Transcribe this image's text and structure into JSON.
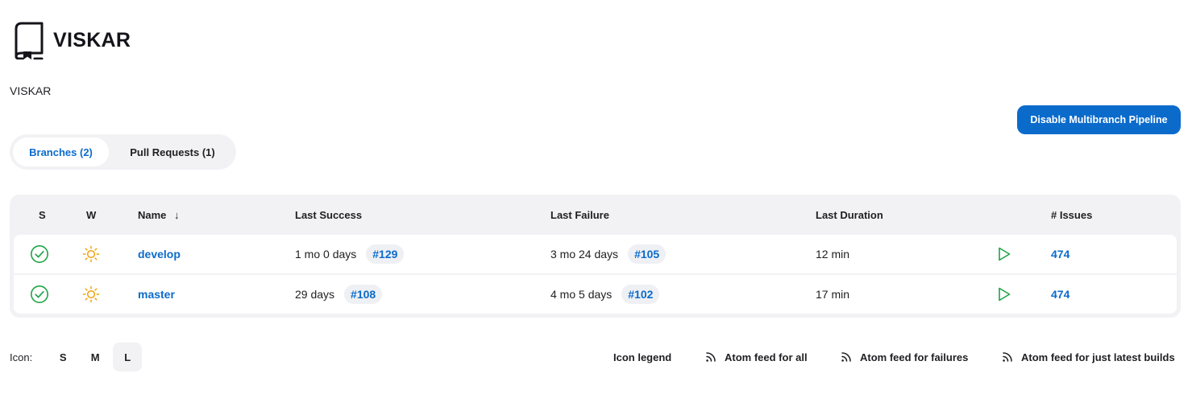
{
  "header": {
    "title": "VISKAR",
    "icon": "repository-book-icon"
  },
  "description": "VISKAR",
  "actions": {
    "disable_label": "Disable Multibranch Pipeline"
  },
  "tabs": [
    {
      "label": "Branches (2)",
      "active": true
    },
    {
      "label": "Pull Requests (1)",
      "active": false
    }
  ],
  "table": {
    "headers": {
      "status": "S",
      "weather": "W",
      "name": "Name",
      "sort_indicator": "↓",
      "last_success": "Last Success",
      "last_failure": "Last Failure",
      "last_duration": "Last Duration",
      "issues": "# Issues"
    },
    "rows": [
      {
        "status": "success-check-icon",
        "weather": "sunny-icon",
        "name": "develop",
        "last_success": "1 mo 0 days",
        "last_success_build": "#129",
        "last_failure": "3 mo 24 days",
        "last_failure_build": "#105",
        "last_duration": "12 min",
        "issues": "474"
      },
      {
        "status": "success-check-icon",
        "weather": "sunny-icon",
        "name": "master",
        "last_success": "29 days",
        "last_success_build": "#108",
        "last_failure": "4 mo 5 days",
        "last_failure_build": "#102",
        "last_duration": "17 min",
        "issues": "474"
      }
    ]
  },
  "footer": {
    "icon_label": "Icon:",
    "sizes": [
      "S",
      "M",
      "L"
    ],
    "active_size": "L",
    "legend": "Icon legend",
    "feeds": [
      "Atom feed for all",
      "Atom feed for failures",
      "Atom feed for just latest builds"
    ]
  },
  "colors": {
    "accent": "#0b6bcb",
    "success": "#1ea446",
    "weather_sun": "#f0a30a",
    "panel": "#f2f2f5"
  }
}
